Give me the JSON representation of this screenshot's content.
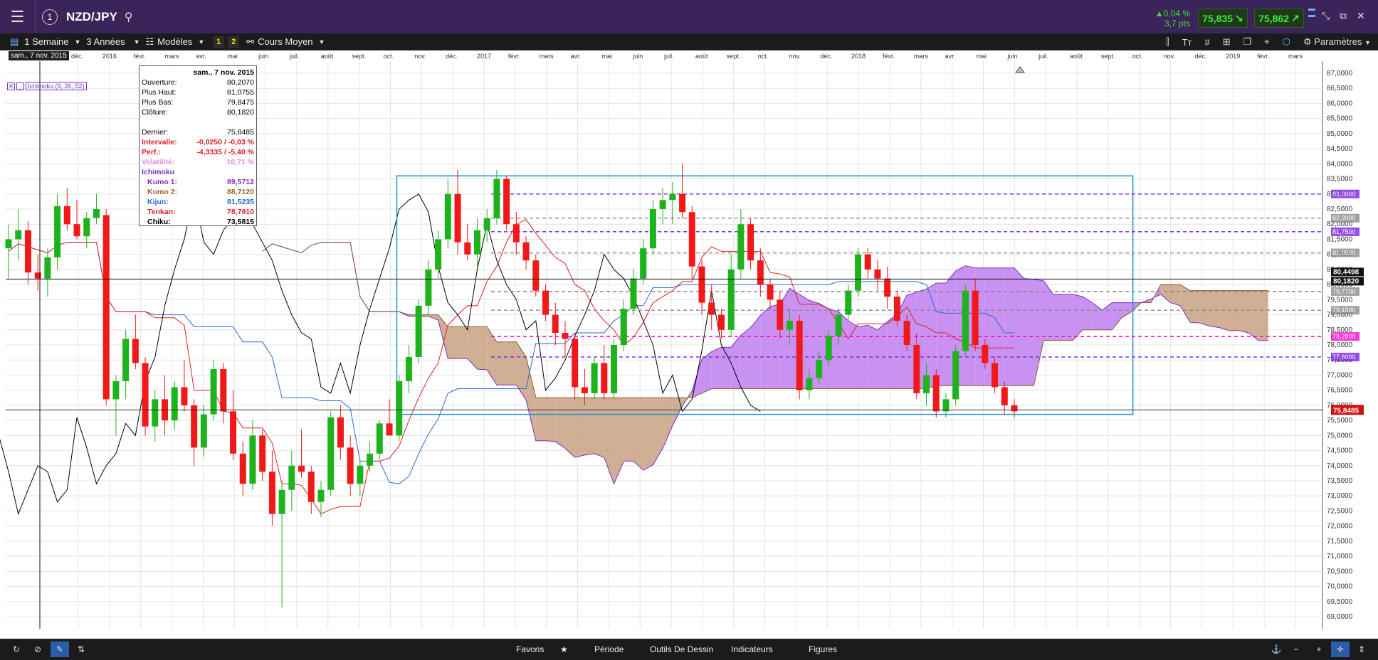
{
  "header": {
    "symbol": "NZD/JPY",
    "change_pct": "▲0,04 %",
    "change_pts": "3,7 pts",
    "sell_price": "75,835",
    "buy_price": "75,862"
  },
  "toolbar": {
    "period": "1 Semaine",
    "range": "3 Années",
    "models": "Modèles",
    "slot1": "1",
    "slot2": "2",
    "chart_type": "Cours Moyen",
    "settings": "Paramètres"
  },
  "bottombar": {
    "favorites": "Favoris",
    "period": "Période",
    "drawing_tools": "Outils De Dessin",
    "indicators": "Indicateurs",
    "figures": "Figures"
  },
  "cursor_date": "sam., 7 nov. 2015",
  "indicator_label": "Ichimoku (9, 26, 52)",
  "infobox": {
    "date": "sam., 7 nov. 2015",
    "rows": [
      {
        "label": "Ouverture:",
        "value": "80,2070",
        "color": "#000000"
      },
      {
        "label": "Plus Haut:",
        "value": "81,0755",
        "color": "#000000"
      },
      {
        "label": "Plus Bas:",
        "value": "79,8475",
        "color": "#000000"
      },
      {
        "label": "Clôture:",
        "value": "80,1820",
        "color": "#000000"
      },
      {
        "label": "",
        "value": "",
        "color": "#000000"
      },
      {
        "label": "Dernier:",
        "value": "75,8485",
        "color": "#000000"
      },
      {
        "label": "Intervalle:",
        "value": "-0,0250 / -0,03 %",
        "color": "#e02020"
      },
      {
        "label": "Perf.:",
        "value": "-4,3335 / -5,40 %",
        "color": "#e02020"
      },
      {
        "label": "Volatilité:",
        "value": "10,71 %",
        "color": "#e28be8"
      },
      {
        "label": "Ichimoku",
        "value": "",
        "color": "#7a2fc4"
      },
      {
        "label": "Kumo 1:",
        "value": "89,5712",
        "color": "#7a2fc4"
      },
      {
        "label": "Kumo 2:",
        "value": "88,7120",
        "color": "#a0622d"
      },
      {
        "label": "Kijun:",
        "value": "81,5235",
        "color": "#2a6bd6"
      },
      {
        "label": "Tenkan:",
        "value": "78,7910",
        "color": "#e02020"
      },
      {
        "label": "Chiku:",
        "value": "73,5815",
        "color": "#000000"
      }
    ]
  },
  "chart_data": {
    "type": "candlestick",
    "x_ticks": [
      "déc.",
      "2016",
      "févr.",
      "mars",
      "avr.",
      "mai",
      "juin",
      "juil.",
      "août",
      "sept.",
      "oct.",
      "nov.",
      "déc.",
      "2017",
      "févr.",
      "mars",
      "avr.",
      "mai",
      "juin",
      "juil.",
      "août",
      "sept.",
      "oct.",
      "nov.",
      "déc.",
      "2018",
      "févr.",
      "mars",
      "avr.",
      "mai",
      "juin",
      "juil.",
      "août",
      "sept.",
      "oct.",
      "nov.",
      "déc.",
      "2019",
      "févr.",
      "mars"
    ],
    "y_ticks": [
      "87,0000",
      "86,5000",
      "86,0000",
      "85,5000",
      "85,0000",
      "84,5000",
      "84,0000",
      "83,5000",
      "83,0000",
      "82,5000",
      "82,0000",
      "81,5000",
      "81,0000",
      "80,5000",
      "80,0000",
      "79,5000",
      "79,0000",
      "78,5000",
      "78,0000",
      "77,5000",
      "77,0000",
      "76,5000",
      "76,0000",
      "75,5000",
      "75,0000",
      "74,5000",
      "74,0000",
      "73,5000",
      "73,0000",
      "72,5000",
      "72,0000",
      "71,5000",
      "71,0000",
      "70,5000",
      "70,0000",
      "69,5000",
      "69,0000"
    ],
    "ylim": [
      68.6,
      87.4
    ],
    "last_price": 75.8485,
    "last_price_label": "75,8485",
    "crosshair_price": 80.182,
    "crosshair_labels": [
      "80,4498",
      "80,1820"
    ],
    "horizontal_levels": [
      {
        "value": 83.0,
        "label": "83,0000",
        "style": "dashed",
        "color": "#7a1fe0"
      },
      {
        "value": 82.2,
        "label": "82,2000",
        "style": "dashed",
        "color": "#888888"
      },
      {
        "value": 81.75,
        "label": "81,7500",
        "style": "dashed",
        "color": "#7a1fe0"
      },
      {
        "value": 81.05,
        "label": "81,0500",
        "style": "dashed",
        "color": "#888888"
      },
      {
        "value": 79.77,
        "label": "79,7700",
        "style": "dashed",
        "color": "#888888"
      },
      {
        "value": 79.15,
        "label": "79,1500",
        "style": "dashed",
        "color": "#888888"
      },
      {
        "value": 78.28,
        "label": "78,2800",
        "style": "dashed",
        "color": "#ff00cc"
      },
      {
        "value": 77.6,
        "label": "77,6000",
        "style": "dashed",
        "color": "#7a1fe0"
      }
    ],
    "range_box": {
      "x_start": 0.297,
      "x_end": 0.856,
      "y_top": 83.6,
      "y_bottom": 75.7
    },
    "series": [
      {
        "name": "Kumo 1",
        "color": "#7a2fc4"
      },
      {
        "name": "Kumo 2",
        "color": "#a0622d"
      },
      {
        "name": "Kijun",
        "color": "#2a6bd6"
      },
      {
        "name": "Tenkan",
        "color": "#e02020"
      },
      {
        "name": "Chiku",
        "color": "#000000"
      }
    ],
    "candles": [
      [
        81.2,
        82.0,
        80.2,
        81.5
      ],
      [
        81.5,
        82.5,
        80.8,
        81.8
      ],
      [
        81.8,
        82.1,
        80.0,
        80.4
      ],
      [
        80.4,
        81.0,
        79.8,
        80.2
      ],
      [
        80.2,
        81.2,
        79.6,
        80.9
      ],
      [
        80.9,
        83.0,
        80.5,
        82.6
      ],
      [
        82.6,
        83.2,
        81.8,
        82.0
      ],
      [
        82.0,
        82.8,
        81.5,
        81.6
      ],
      [
        81.6,
        82.4,
        81.2,
        82.2
      ],
      [
        82.2,
        83.0,
        82.0,
        82.5
      ],
      [
        82.3,
        82.5,
        76.0,
        76.2
      ],
      [
        76.2,
        77.0,
        75.0,
        76.8
      ],
      [
        76.8,
        78.5,
        76.2,
        78.2
      ],
      [
        78.2,
        79.0,
        77.2,
        77.4
      ],
      [
        77.4,
        77.6,
        75.0,
        75.3
      ],
      [
        75.3,
        76.5,
        74.8,
        76.2
      ],
      [
        76.2,
        77.0,
        75.0,
        75.5
      ],
      [
        75.5,
        76.8,
        75.2,
        76.6
      ],
      [
        76.6,
        77.5,
        75.8,
        76.0
      ],
      [
        76.0,
        76.2,
        74.0,
        74.6
      ],
      [
        74.6,
        76.0,
        74.3,
        75.7
      ],
      [
        75.7,
        77.5,
        75.5,
        77.2
      ],
      [
        77.2,
        77.4,
        75.4,
        75.8
      ],
      [
        75.8,
        76.5,
        74.2,
        74.4
      ],
      [
        74.4,
        74.8,
        73.0,
        73.4
      ],
      [
        73.4,
        75.5,
        73.2,
        75.0
      ],
      [
        75.0,
        75.2,
        73.5,
        73.8
      ],
      [
        73.8,
        74.5,
        72.0,
        72.4
      ],
      [
        72.4,
        73.5,
        69.3,
        73.2
      ],
      [
        73.2,
        74.5,
        72.5,
        74.0
      ],
      [
        74.0,
        75.2,
        73.6,
        73.8
      ],
      [
        73.8,
        74.0,
        72.4,
        72.8
      ],
      [
        72.8,
        73.5,
        72.3,
        73.2
      ],
      [
        73.2,
        75.8,
        73.0,
        75.6
      ],
      [
        75.6,
        76.0,
        74.2,
        74.6
      ],
      [
        74.6,
        75.0,
        73.0,
        73.4
      ],
      [
        73.4,
        74.2,
        73.0,
        74.0
      ],
      [
        74.0,
        74.8,
        73.8,
        74.4
      ],
      [
        74.4,
        75.5,
        74.2,
        75.4
      ],
      [
        75.4,
        76.2,
        75.0,
        75.0
      ],
      [
        75.0,
        77.0,
        74.8,
        76.8
      ],
      [
        76.8,
        78.0,
        76.4,
        77.6
      ],
      [
        77.6,
        79.5,
        77.4,
        79.3
      ],
      [
        79.3,
        80.8,
        79.0,
        80.5
      ],
      [
        80.5,
        81.8,
        80.2,
        81.5
      ],
      [
        81.5,
        83.5,
        81.2,
        83.0
      ],
      [
        83.0,
        83.8,
        81.0,
        81.4
      ],
      [
        81.4,
        82.0,
        80.8,
        81.0
      ],
      [
        81.0,
        82.2,
        80.6,
        81.8
      ],
      [
        81.8,
        82.5,
        81.4,
        82.2
      ],
      [
        82.2,
        83.8,
        82.0,
        83.5
      ],
      [
        83.5,
        83.6,
        81.8,
        82.0
      ],
      [
        82.0,
        82.4,
        81.0,
        81.4
      ],
      [
        81.4,
        81.6,
        80.5,
        80.8
      ],
      [
        80.8,
        81.0,
        79.6,
        79.8
      ],
      [
        79.8,
        80.0,
        78.8,
        79.0
      ],
      [
        79.0,
        79.4,
        78.0,
        78.4
      ],
      [
        78.4,
        78.8,
        77.6,
        78.2
      ],
      [
        78.2,
        78.4,
        76.2,
        76.6
      ],
      [
        76.6,
        77.2,
        76.0,
        76.4
      ],
      [
        76.4,
        77.6,
        76.2,
        77.4
      ],
      [
        77.4,
        78.0,
        76.2,
        76.4
      ],
      [
        76.4,
        78.2,
        76.2,
        78.0
      ],
      [
        78.0,
        79.5,
        77.8,
        79.2
      ],
      [
        79.2,
        80.5,
        79.0,
        80.2
      ],
      [
        80.2,
        81.5,
        80.0,
        81.2
      ],
      [
        81.2,
        82.8,
        81.0,
        82.5
      ],
      [
        82.5,
        83.2,
        82.0,
        82.8
      ],
      [
        82.8,
        83.4,
        82.0,
        83.0
      ],
      [
        83.0,
        84.0,
        82.2,
        82.4
      ],
      [
        82.4,
        82.6,
        80.2,
        80.6
      ],
      [
        80.6,
        80.8,
        79.0,
        79.4
      ],
      [
        79.4,
        80.0,
        78.5,
        79.0
      ],
      [
        79.0,
        79.2,
        78.2,
        78.5
      ],
      [
        78.5,
        81.0,
        78.3,
        80.5
      ],
      [
        80.5,
        82.5,
        80.2,
        82.0
      ],
      [
        82.0,
        82.2,
        80.5,
        80.8
      ],
      [
        80.8,
        81.2,
        79.6,
        80.0
      ],
      [
        80.0,
        80.2,
        79.2,
        79.5
      ],
      [
        79.5,
        79.8,
        78.2,
        78.5
      ],
      [
        78.5,
        79.2,
        78.0,
        78.8
      ],
      [
        78.8,
        79.0,
        76.2,
        76.5
      ],
      [
        76.5,
        77.2,
        76.2,
        76.9
      ],
      [
        76.9,
        77.8,
        76.7,
        77.5
      ],
      [
        77.5,
        78.5,
        77.3,
        78.3
      ],
      [
        78.3,
        79.2,
        78.0,
        79.0
      ],
      [
        79.0,
        80.0,
        78.8,
        79.8
      ],
      [
        79.8,
        81.2,
        79.6,
        81.0
      ],
      [
        81.0,
        81.2,
        80.2,
        80.5
      ],
      [
        80.5,
        80.8,
        79.8,
        80.2
      ],
      [
        80.2,
        80.6,
        79.2,
        79.6
      ],
      [
        79.6,
        79.8,
        78.6,
        78.8
      ],
      [
        78.8,
        79.0,
        77.8,
        78.0
      ],
      [
        78.0,
        78.4,
        76.2,
        76.4
      ],
      [
        76.4,
        77.4,
        76.0,
        77.0
      ],
      [
        77.0,
        77.2,
        75.6,
        75.8
      ],
      [
        75.8,
        76.4,
        75.6,
        76.2
      ],
      [
        76.2,
        78.0,
        76.0,
        77.8
      ],
      [
        77.8,
        80.0,
        77.6,
        79.8
      ],
      [
        79.8,
        80.2,
        77.8,
        78.0
      ],
      [
        78.0,
        78.2,
        77.2,
        77.4
      ],
      [
        77.4,
        77.6,
        76.4,
        76.6
      ],
      [
        76.6,
        76.8,
        75.7,
        76.0
      ],
      [
        76.0,
        76.2,
        75.6,
        75.8
      ]
    ]
  }
}
